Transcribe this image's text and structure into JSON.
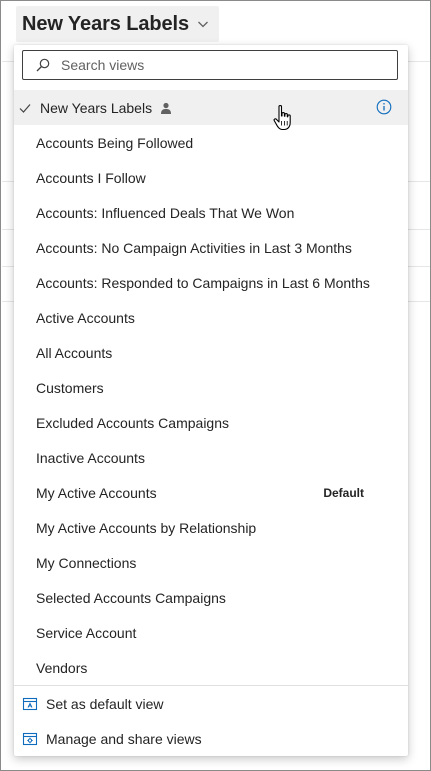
{
  "header": {
    "title": "New Years Labels"
  },
  "search": {
    "placeholder": "Search views",
    "value": ""
  },
  "views": {
    "selected": "New Years Labels",
    "items": [
      {
        "label": "New Years Labels"
      },
      {
        "label": "Accounts Being Followed"
      },
      {
        "label": "Accounts I Follow"
      },
      {
        "label": "Accounts: Influenced Deals That We Won"
      },
      {
        "label": "Accounts: No Campaign Activities in Last 3 Months"
      },
      {
        "label": "Accounts: Responded to Campaigns in Last 6 Months"
      },
      {
        "label": "Active Accounts"
      },
      {
        "label": "All Accounts"
      },
      {
        "label": "Customers"
      },
      {
        "label": "Excluded Accounts Campaigns"
      },
      {
        "label": "Inactive Accounts"
      },
      {
        "label": "My Active Accounts",
        "badge": "Default"
      },
      {
        "label": "My Active Accounts by Relationship"
      },
      {
        "label": "My Connections"
      },
      {
        "label": "Selected Accounts Campaigns"
      },
      {
        "label": "Service Account"
      },
      {
        "label": "Vendors"
      }
    ]
  },
  "footer": {
    "set_default": "Set as default view",
    "manage": "Manage and share views"
  },
  "colors": {
    "accent": "#0f6cbd",
    "text": "#242424",
    "selected_bg": "#f0f0f0"
  },
  "icons": {
    "check": "checkmark-icon",
    "personal": "person-icon",
    "info": "info-icon",
    "set_default": "default-view-icon",
    "manage": "manage-views-icon"
  }
}
